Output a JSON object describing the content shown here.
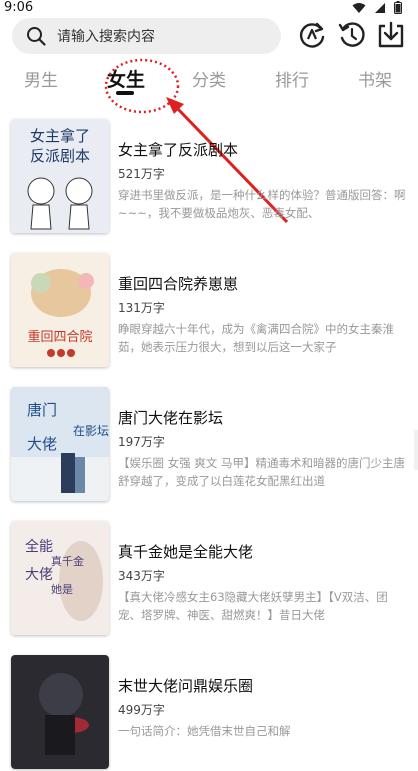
{
  "status": {
    "time": "9:06"
  },
  "search": {
    "placeholder": "请输入搜索内容"
  },
  "tabs": [
    {
      "label": "男生"
    },
    {
      "label": "女生"
    },
    {
      "label": "分类"
    },
    {
      "label": "排行"
    },
    {
      "label": "书架"
    }
  ],
  "books": [
    {
      "title": "女主拿了反派剧本",
      "words": "521万字",
      "desc": "穿进书里做反派，是一种什么样的体验？普通版回答：啊~~~，我不要做极品炮灰、恶毒女配、",
      "cover_text": "女主拿了反派剧本"
    },
    {
      "title": "重回四合院养崽崽",
      "words": "131万字",
      "desc": "睁眼穿越六十年代，成为《禽满四合院》中的女主秦淮茹，她表示压力很大，想到以后这一大家子",
      "cover_text": "重回四合院"
    },
    {
      "title": "唐门大佬在影坛",
      "words": "197万字",
      "desc": "【娱乐圈 女强 爽文 马甲】精通毒术和暗器的唐门少主唐舒穿越了，变成了以白莲花女配黑红出道",
      "cover_text": "唐门大佬在影坛"
    },
    {
      "title": "真千金她是全能大佬",
      "words": "343万字",
      "desc": "【真大佬冷感女主63隐藏大佬妖孽男主】【V双洁、团宠、塔罗牌、神医、甜燃爽！】昔日大佬",
      "cover_text": "全能大佬真千金她是"
    },
    {
      "title": "末世大佬问鼎娱乐圈",
      "words": "499万字",
      "desc": "一句话简介：她凭借末世自己和解",
      "cover_text": ""
    }
  ],
  "colors": {
    "annotation": "#e02020",
    "accent": "#111111"
  }
}
